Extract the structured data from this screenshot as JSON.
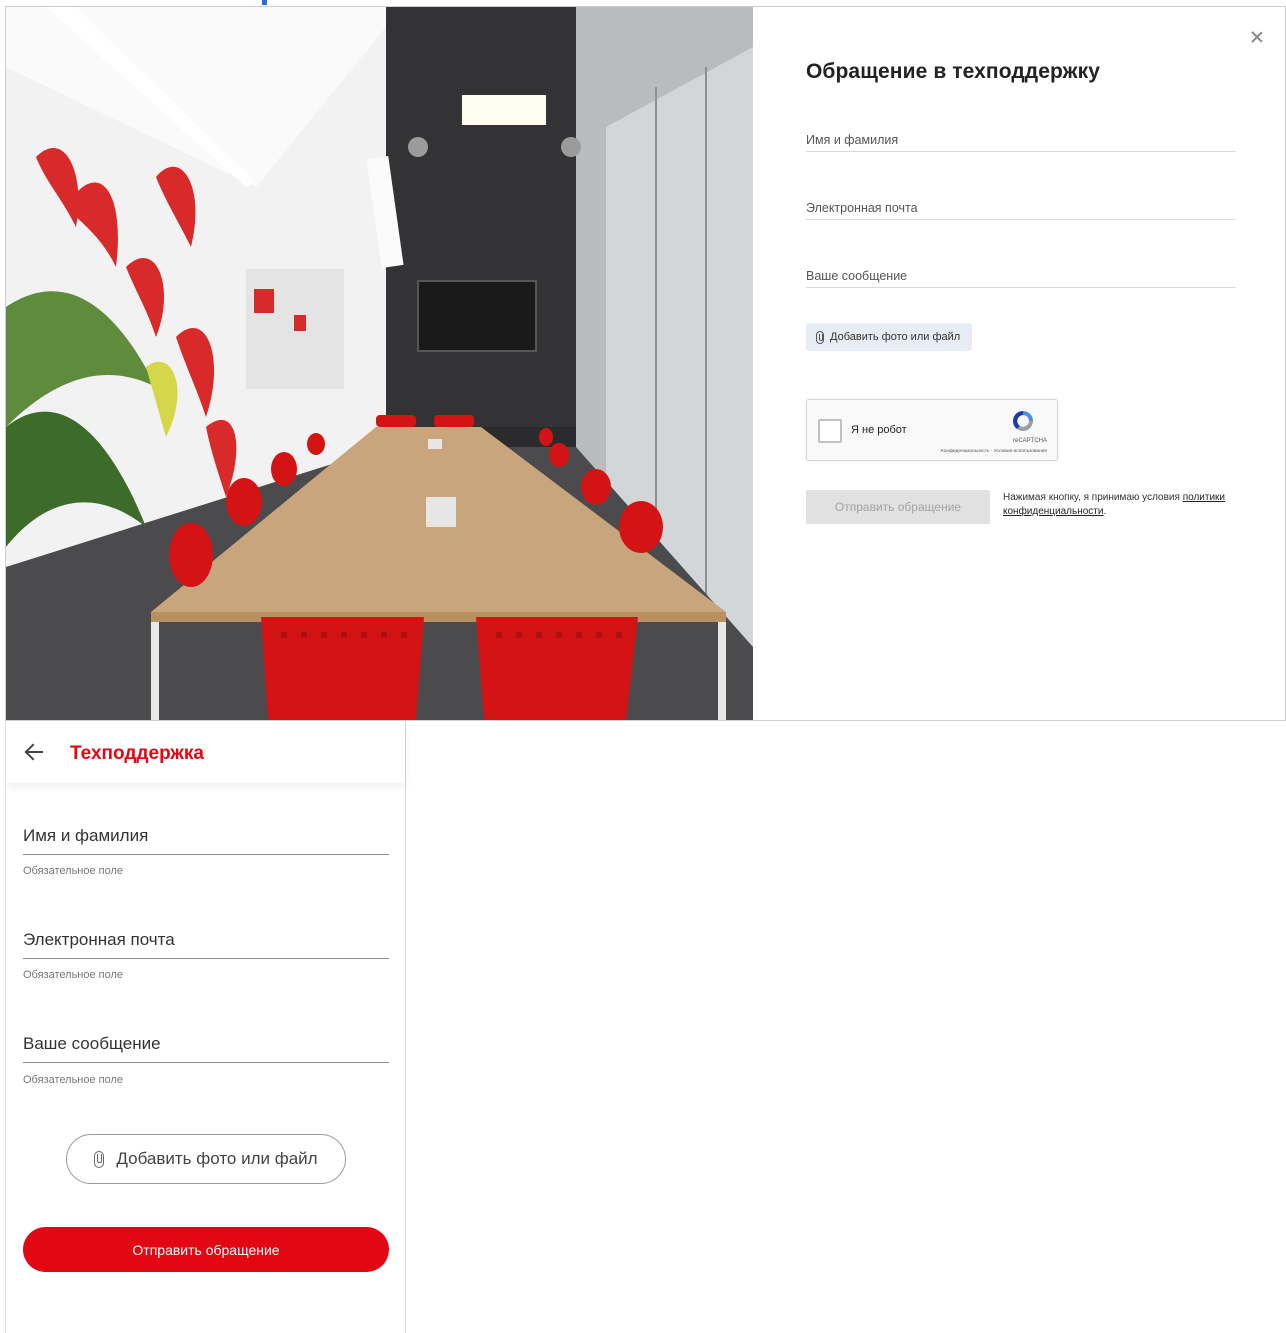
{
  "desktop": {
    "title": "Обращение в техподдержку",
    "fields": {
      "name_placeholder": "Имя и фамилия",
      "email_placeholder": "Электронная почта",
      "message_placeholder": "Ваше сообщение"
    },
    "attach_label": "Добавить фото или файл",
    "captcha": {
      "label": "Я не робот",
      "brand": "reCAPTCHA",
      "links": "Конфиденциальность - Условия использования"
    },
    "submit_label": "Отправить обращение",
    "consent_text": "Нажимая кнопку, я принимаю условия",
    "consent_link": "политики конфиденциальности",
    "consent_end": "."
  },
  "mobile": {
    "title": "Техподдержка",
    "fields": {
      "name_placeholder": "Имя и фамилия",
      "email_placeholder": "Электронная почта",
      "message_placeholder": "Ваше сообщение"
    },
    "hints": {
      "name": "Обязательное поле",
      "email": "Обязательное поле",
      "message": "Обязательное поле"
    },
    "attach_label": "Добавить фото или файл",
    "submit_label": "Отправить обращение"
  },
  "colors": {
    "brand_red": "#e30613",
    "disabled_button": "#e1e1e1",
    "attach_bg": "#e8edf5"
  }
}
